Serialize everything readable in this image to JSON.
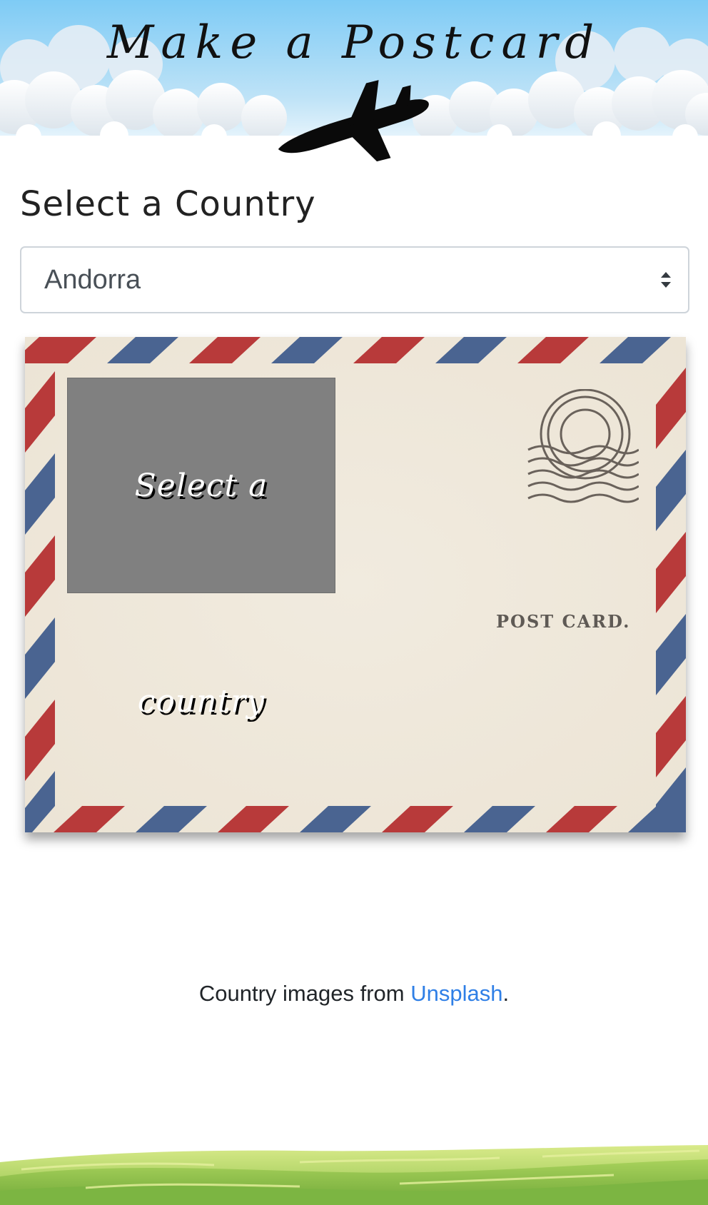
{
  "header": {
    "title": "Make a Postcard"
  },
  "country_section": {
    "heading": "Select a Country",
    "selected_country": "Andorra"
  },
  "postcard": {
    "photo_placeholder": "Select a country",
    "label": "POST CARD."
  },
  "credit": {
    "prefix": "Country images from ",
    "link_text": "Unsplash",
    "suffix": "."
  },
  "colors": {
    "sky_top": "#7ecbf5",
    "stripe_red": "#b83a3a",
    "stripe_blue": "#4a6491",
    "link": "#2f7fe6",
    "grass": "#8fc24a"
  },
  "icons": {
    "airplane": "airplane-icon",
    "postmark": "postmark-stamp-icon",
    "select_arrows": "sort-arrows-icon"
  }
}
